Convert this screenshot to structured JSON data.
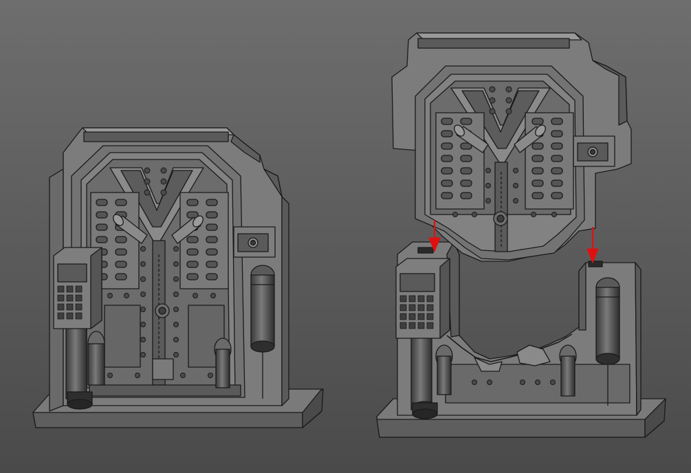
{
  "scene": {
    "background_top": "#6e6e6e",
    "background_bottom": "#4a4a4a",
    "model_light": "#8a8a8a",
    "model_mid": "#6a6a6a",
    "model_dark": "#3c3c3c",
    "outline": "#1a1a1a",
    "arrow_color": "#e01010"
  },
  "models": [
    {
      "name": "assembled-door-model",
      "state": "assembled"
    },
    {
      "name": "exploded-door-model",
      "state": "exploded"
    }
  ],
  "arrows": [
    {
      "name": "left-insert-arrow",
      "icon": "down-arrow-icon"
    },
    {
      "name": "right-insert-arrow",
      "icon": "down-arrow-icon"
    }
  ]
}
